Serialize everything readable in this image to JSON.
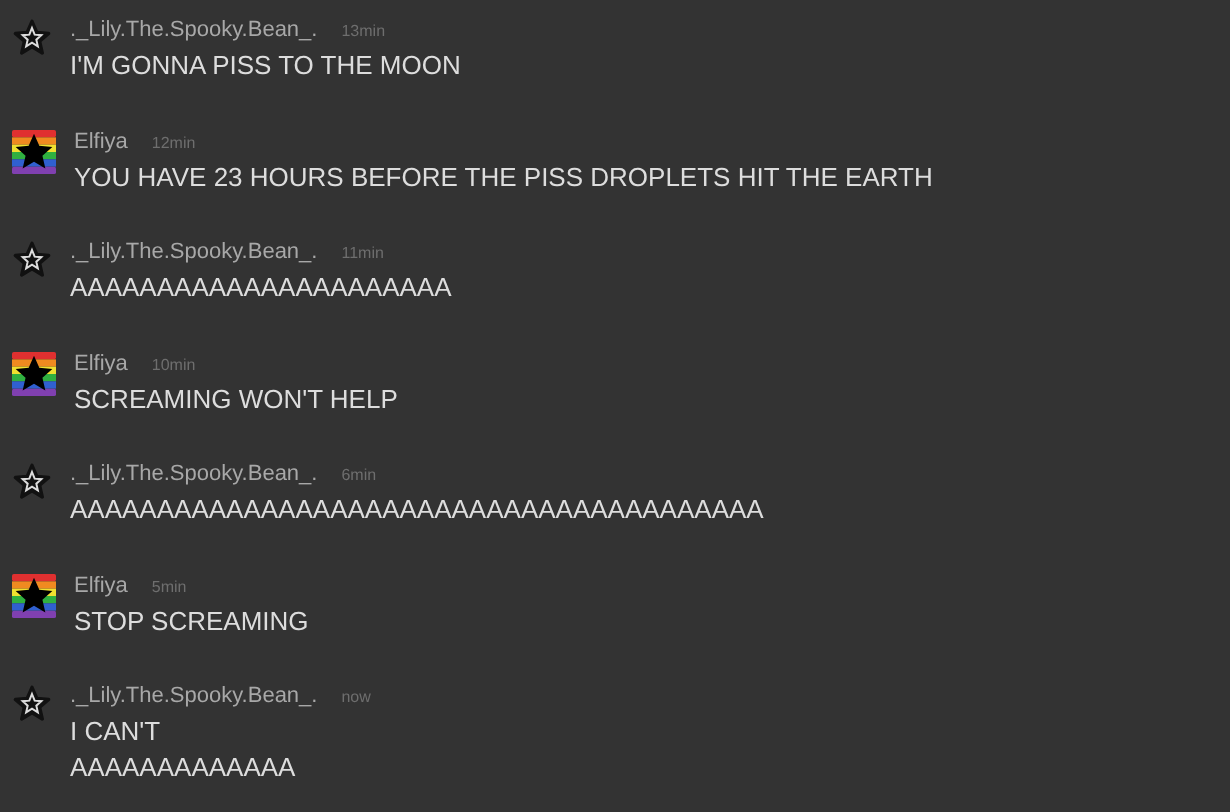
{
  "messages": [
    {
      "kind": "outline",
      "author": "._Lily.The.Spooky.Bean_.",
      "time": "13min",
      "lines": [
        "I'M GONNA PISS TO THE MOON"
      ]
    },
    {
      "kind": "rainbow",
      "author": "Elfiya",
      "time": "12min",
      "lines": [
        "YOU HAVE 23 HOURS BEFORE THE PISS DROPLETS HIT THE EARTH"
      ]
    },
    {
      "kind": "outline",
      "author": "._Lily.The.Spooky.Bean_.",
      "time": "11min",
      "lines": [
        "AAAAAAAAAAAAAAAAAAAAAA"
      ]
    },
    {
      "kind": "rainbow",
      "author": "Elfiya",
      "time": "10min",
      "lines": [
        "SCREAMING WON'T HELP"
      ]
    },
    {
      "kind": "outline",
      "author": "._Lily.The.Spooky.Bean_.",
      "time": "6min",
      "lines": [
        "AAAAAAAAAAAAAAAAAAAAAAAAAAAAAAAAAAAAAAAA"
      ]
    },
    {
      "kind": "rainbow",
      "author": "Elfiya",
      "time": "5min",
      "lines": [
        "STOP SCREAMING"
      ]
    },
    {
      "kind": "outline",
      "author": "._Lily.The.Spooky.Bean_.",
      "time": "now",
      "lines": [
        "I CAN'T",
        "AAAAAAAAAAAAA"
      ]
    }
  ]
}
